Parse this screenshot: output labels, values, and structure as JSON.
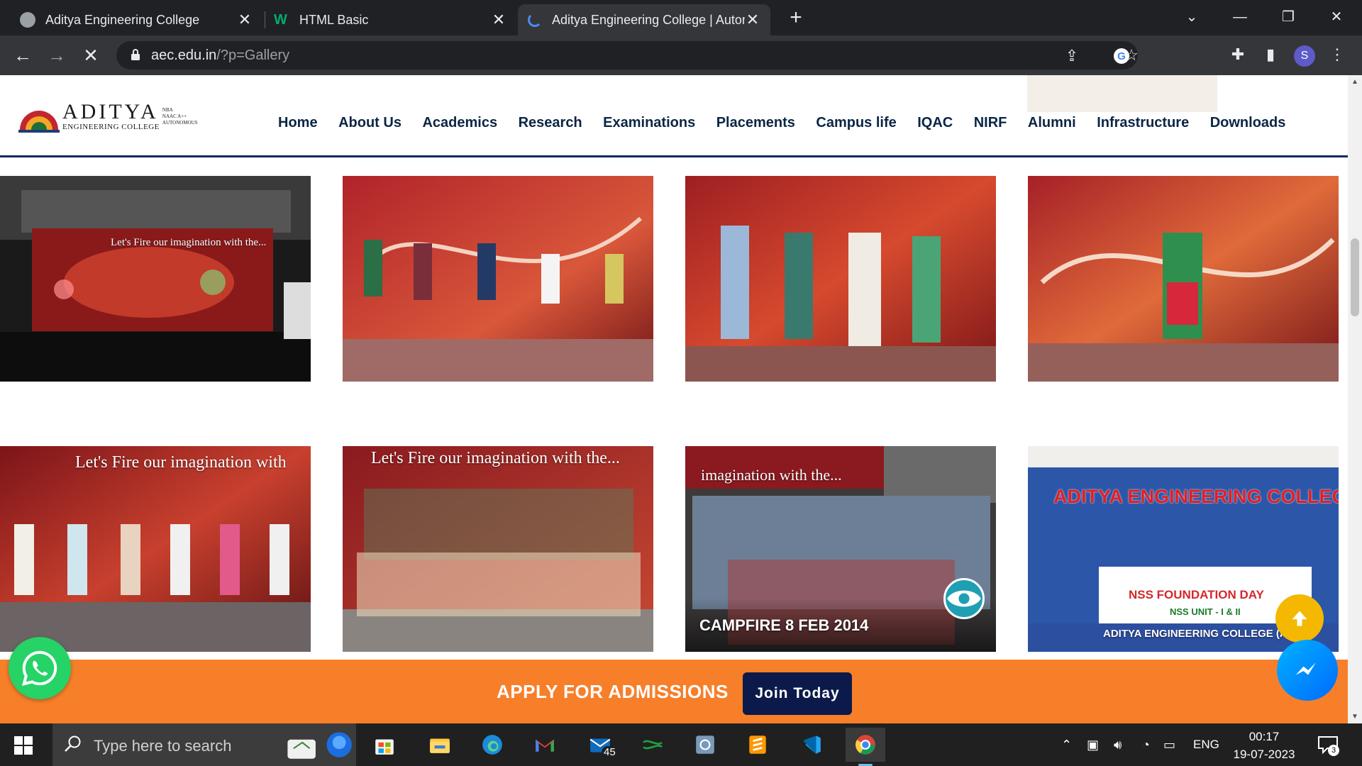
{
  "browser": {
    "tabs": [
      {
        "title": "Aditya Engineering College",
        "active": false
      },
      {
        "title": "HTML Basic",
        "active": false
      },
      {
        "title": "Aditya Engineering College | Autonomous",
        "active": true
      }
    ],
    "url_host": "aec.edu.in",
    "url_path": "/?p=Gallery",
    "profile_initial": "S"
  },
  "site": {
    "logo": {
      "name": "ADITYA",
      "subtitle": "ENGINEERING COLLEGE",
      "badge1": "NBA",
      "badge2": "NAAC A++",
      "badge3": "AUTONOMOUS"
    },
    "menu": [
      "Home",
      "About Us",
      "Academics",
      "Research",
      "Examinations",
      "Placements",
      "Campus life",
      "IQAC",
      "NIRF",
      "Alumni",
      "Infrastructure",
      "Downloads"
    ],
    "gallery": [
      {
        "banner": "Let's Fire our imagination with the..."
      },
      {
        "banner": ""
      },
      {
        "banner": ""
      },
      {
        "banner": ""
      },
      {
        "banner": "Let's Fire our imagination with"
      },
      {
        "banner": "Let's Fire our imagination with the..."
      },
      {
        "banner": "imagination with the...",
        "caption": "CAMPFIRE 8 FEB 2014"
      },
      {
        "banner": "ADITYA ENGINEERING COLLEGE",
        "sub1": "NSS FOUNDATION DAY",
        "sub2": "NSS UNIT - I & II",
        "sub3": "ADITYA ENGINEERING COLLEGE (A)"
      }
    ],
    "admission": {
      "label": "APPLY FOR ADMISSIONS",
      "button": "Join Today"
    }
  },
  "taskbar": {
    "search_placeholder": "Type here to search",
    "mail_badge": "45",
    "language": "ENG",
    "time": "00:17",
    "date": "19-07-2023",
    "notification_count": "3"
  },
  "colors": {
    "nav_text": "#0b2545",
    "admission_bg": "#f77f2a",
    "join_bg": "#0b1a4a",
    "whatsapp": "#25d366"
  }
}
